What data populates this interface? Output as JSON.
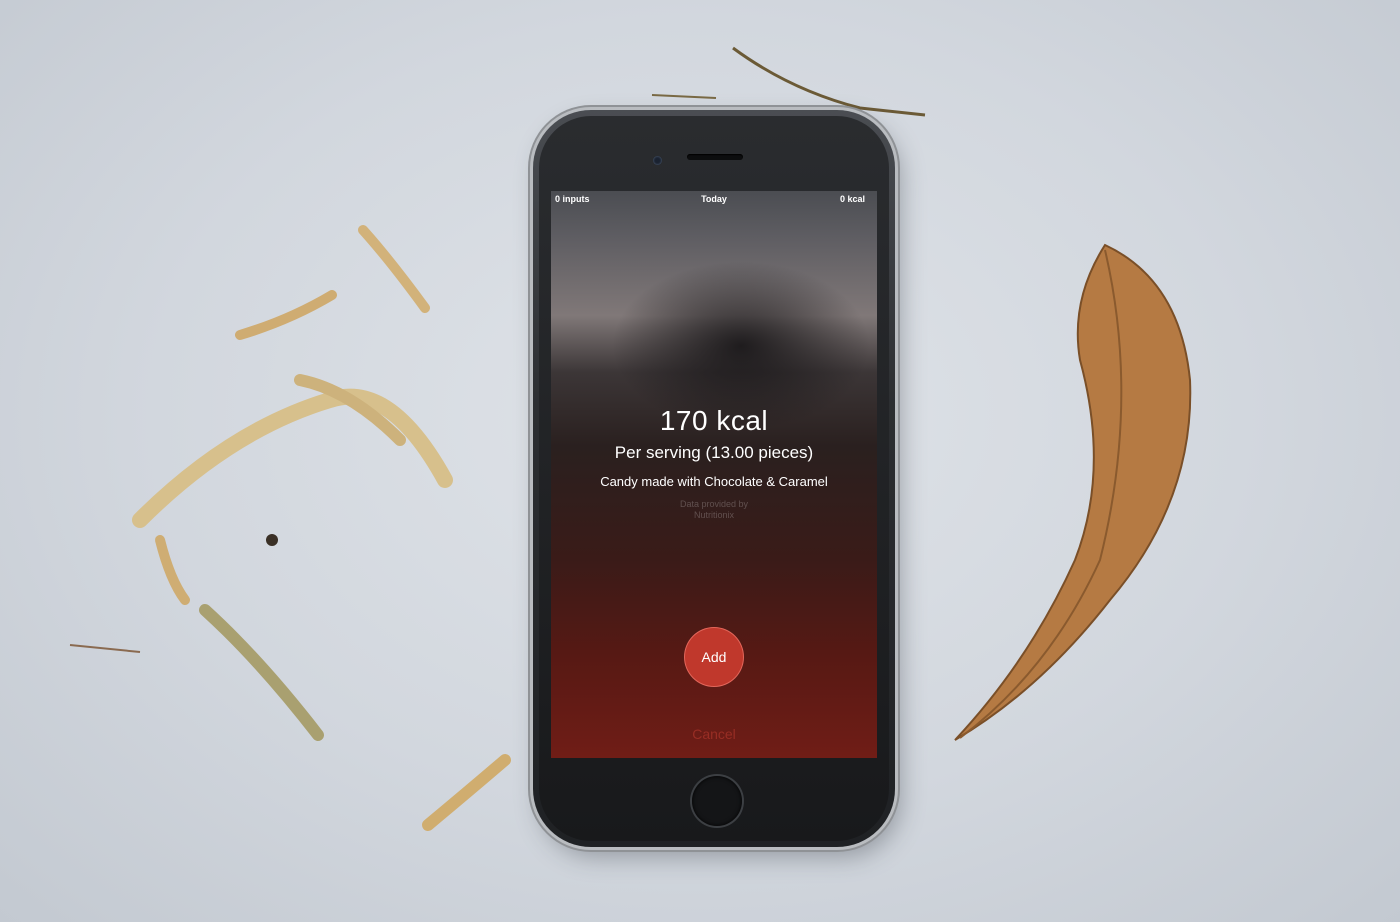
{
  "status_bar": {
    "inputs": "0 inputs",
    "day": "Today",
    "total_kcal": "0 kcal"
  },
  "food": {
    "calories": "170 kcal",
    "serving": "Per serving (13.00 pieces)",
    "description": "Candy made with Chocolate & Caramel",
    "credit_line1": "Data provided by",
    "credit_line2": "Nutritionix"
  },
  "actions": {
    "add_label": "Add",
    "cancel_label": "Cancel"
  },
  "colors": {
    "add_button": "#c0382c",
    "surface": "#d6dbe1"
  }
}
